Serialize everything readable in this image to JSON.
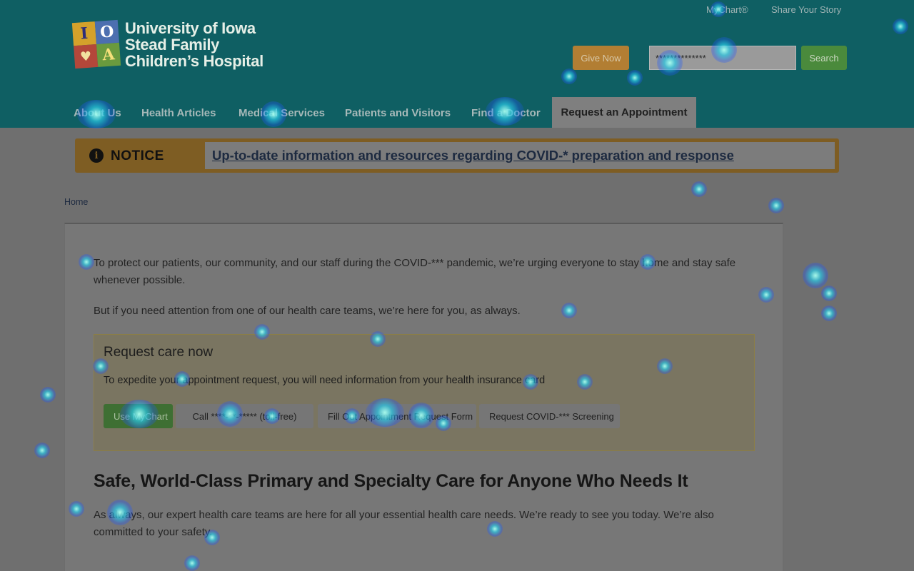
{
  "header": {
    "logo_lines": [
      "University of Iowa",
      "Stead Family",
      "Children’s Hospital"
    ],
    "logo_tiles": [
      "I",
      "O",
      "♥",
      "A"
    ],
    "utility_links": [
      "MyChart®",
      "Share Your Story"
    ],
    "give_button": "Give Now",
    "search": {
      "value": "**************",
      "button": "Search"
    },
    "nav": [
      "About Us",
      "Health Articles",
      "Medical Services",
      "Patients and Visitors",
      "Find a Doctor"
    ],
    "nav_active": "Request an Appointment"
  },
  "notice": {
    "icon": "info-icon",
    "label": "NOTICE",
    "link": "Up-to-date information and resources regarding COVID-* preparation and response"
  },
  "breadcrumb": "Home",
  "content": {
    "intro_1": "To protect our patients, our community, and our staff during the COVID-*** pandemic, we’re urging everyone to stay home and stay safe whenever possible.",
    "intro_2": "But if you need attention from one of our health care teams, we’re here for you, as always.",
    "care_box": {
      "title": "Request care now",
      "description": "To expedite your appointment request, you will need information from your health insurance card",
      "buttons": [
        "Use MyChart",
        "Call ****-**-***** (toll-free)",
        "Fill Out Appointment Request Form",
        "Request COVID-*** Screening"
      ]
    },
    "section_title": "Safe, World-Class Primary and Specialty Care for Anyone Who Needs It",
    "section_text": "As always, our expert health care teams are here for all your essential health care needs. We’re ready to see you today. We’re also committed to your safety."
  },
  "colors": {
    "header_bg": "#0f5f63",
    "notice_gold": "#7e5d23",
    "primary_green": "#3e6f33",
    "give_orange": "#b27e33"
  }
}
